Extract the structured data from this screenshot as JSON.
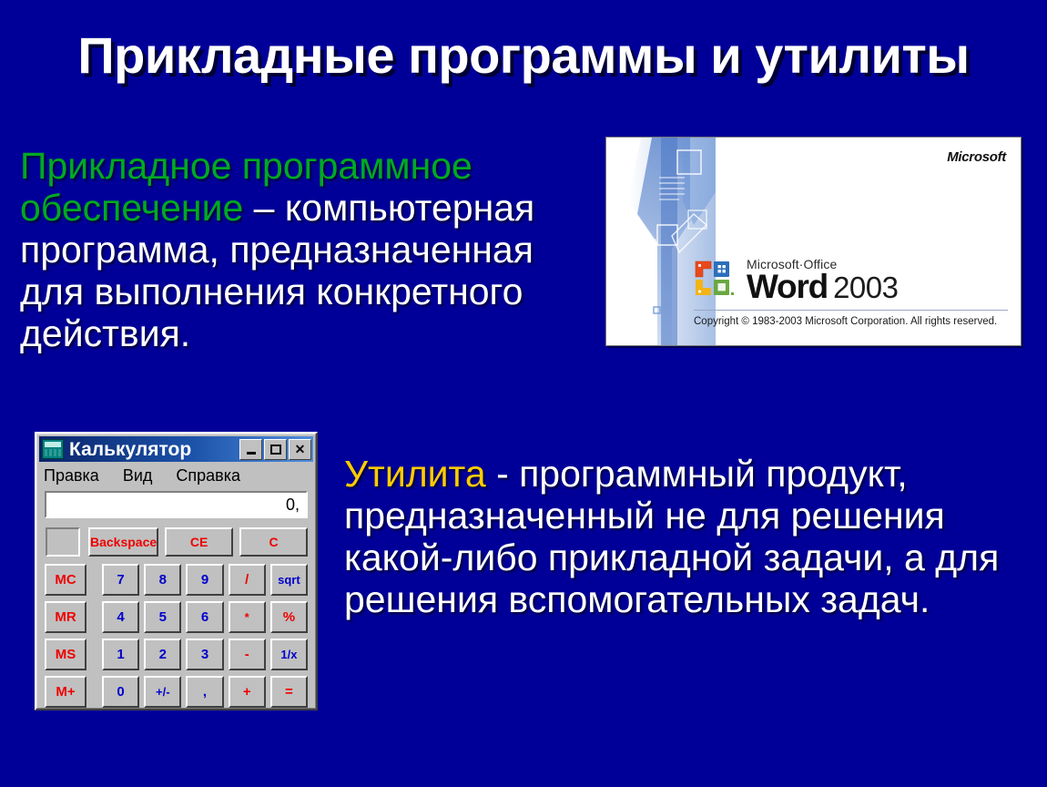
{
  "slide": {
    "title": "Прикладные программы и утилиты",
    "background_color": "#000099"
  },
  "definitions": {
    "left": {
      "term": "Прикладное программное обеспечение",
      "term_color": "#00aa22",
      "body": " – компьютерная программа, предназначенная для выполнения конкретного действия."
    },
    "right": {
      "term": "Утилита",
      "term_color": "#ffcc00",
      "body": " - программный продукт, предназначенный не для решения какой-либо прикладной задачи, а для решения вспомогательных задач."
    }
  },
  "word_splash": {
    "brand": "Microsoft",
    "office_line": "Microsoft·Office",
    "product": "Word",
    "version": "2003",
    "copyright": "Copyright © 1983-2003 Microsoft Corporation.  All rights reserved.",
    "logo_colors": {
      "top_left": "#e8491d",
      "top_right": "#2c6fbb",
      "bottom_left": "#f2b417",
      "bottom_right": "#6aa842"
    }
  },
  "calculator": {
    "window_title": "Калькулятор",
    "icon": "calculator-icon",
    "window_buttons": {
      "minimize": "_",
      "maximize": "□",
      "close": "✕"
    },
    "menu": [
      "Правка",
      "Вид",
      "Справка"
    ],
    "display_value": "0,",
    "memory_indicator": "",
    "top_row": [
      "Backspace",
      "CE",
      "C"
    ],
    "rows": [
      {
        "memory": "MC",
        "keys": [
          "7",
          "8",
          "9",
          "/",
          "sqrt"
        ]
      },
      {
        "memory": "MR",
        "keys": [
          "4",
          "5",
          "6",
          "*",
          "%"
        ]
      },
      {
        "memory": "MS",
        "keys": [
          "1",
          "2",
          "3",
          "-",
          "1/x"
        ]
      },
      {
        "memory": "M+",
        "keys": [
          "0",
          "+/-",
          ",",
          "+",
          "="
        ]
      }
    ],
    "colors": {
      "digit": "#0000cc",
      "operator": "#ee0000",
      "memory": "#ee0000",
      "face": "#c0c0c0"
    }
  }
}
